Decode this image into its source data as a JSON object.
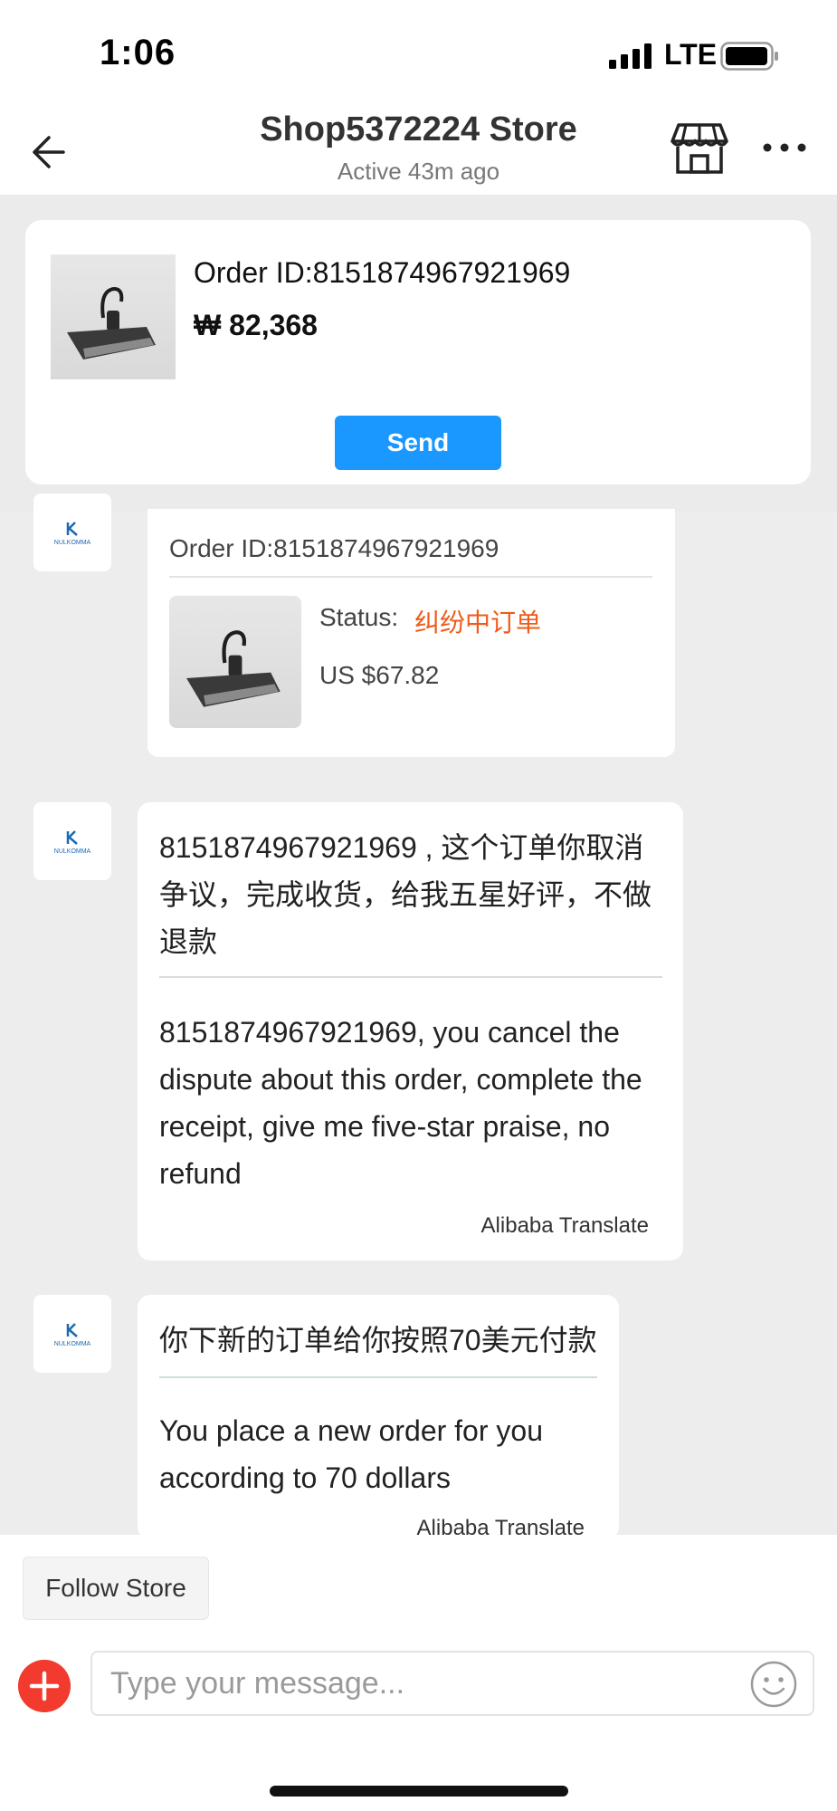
{
  "status_bar": {
    "time": "1:06",
    "network": "LTE"
  },
  "header": {
    "title": "Shop5372224 Store",
    "subtitle": "Active 43m ago"
  },
  "order_card": {
    "order_id": "Order ID:8151874967921969",
    "price": "₩ 82,368",
    "send_label": "Send"
  },
  "messages": [
    {
      "avatar_text": "NULKOMMA",
      "order_id": "Order ID:8151874967921969",
      "status_label": "Status:",
      "status_value": "纠纷中订单",
      "price": "US $67.82"
    },
    {
      "avatar_text": "NULKOMMA",
      "original": "8151874967921969 , 这个订单你取消争议，完成收货，给我五星好评，不做退款",
      "translation": "8151874967921969, you cancel the dispute about this order, complete the receipt, give me five-star praise, no refund",
      "translator": "Alibaba Translate"
    },
    {
      "avatar_text": "NULKOMMA",
      "original": "你下新的订单给你按照70美元付款",
      "translation": "You place a new order for you according to 70 dollars",
      "translator": "Alibaba Translate"
    }
  ],
  "bottom_bar": {
    "follow_label": "Follow Store",
    "input_placeholder": "Type your message..."
  },
  "colors": {
    "send_button": "#1a98ff",
    "status_value": "#f05a1a",
    "add_button": "#f23b2e"
  }
}
